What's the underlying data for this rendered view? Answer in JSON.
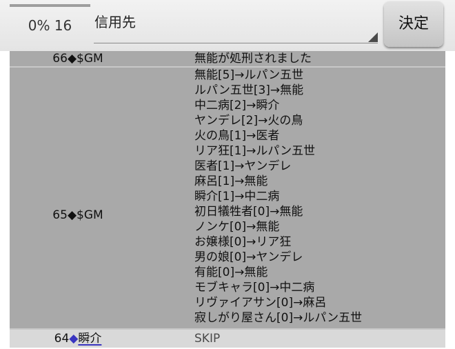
{
  "header": {
    "percent": "0%",
    "count": "16",
    "target_label": "信用先",
    "decide_label": "決定"
  },
  "log": [
    {
      "number": "66",
      "speaker": "$GM",
      "lines": [
        "無能が処刑されました"
      ]
    },
    {
      "number": "65",
      "speaker": "$GM",
      "lines": [
        "無能[5]→ルパン五世",
        "ルパン五世[3]→無能",
        "中二病[2]→瞬介",
        "ヤンデレ[2]→火の鳥",
        "火の鳥[1]→医者",
        "リア狂[1]→ルパン五世",
        "医者[1]→ヤンデレ",
        "麻呂[1]→無能",
        "瞬介[1]→中二病",
        "初日犠牲者[0]→無能",
        "ノンケ[0]→無能",
        "お嬢様[0]→リア狂",
        "男の娘[0]→ヤンデレ",
        "有能[0]→無能",
        "モブキャラ[0]→中二病",
        "リヴァイアサン[0]→麻呂",
        "寂しがり屋さん[0]→ルパン五世"
      ]
    },
    {
      "number": "64",
      "speaker": "瞬介",
      "lines": [
        "SKIP"
      ]
    }
  ],
  "diamond_glyph": "◆",
  "colors": {
    "topbar": "#e8e8e8",
    "gm_row": "#a9a9a9",
    "player_row": "#d9d9d9",
    "player_accent": "#3a35c0"
  }
}
